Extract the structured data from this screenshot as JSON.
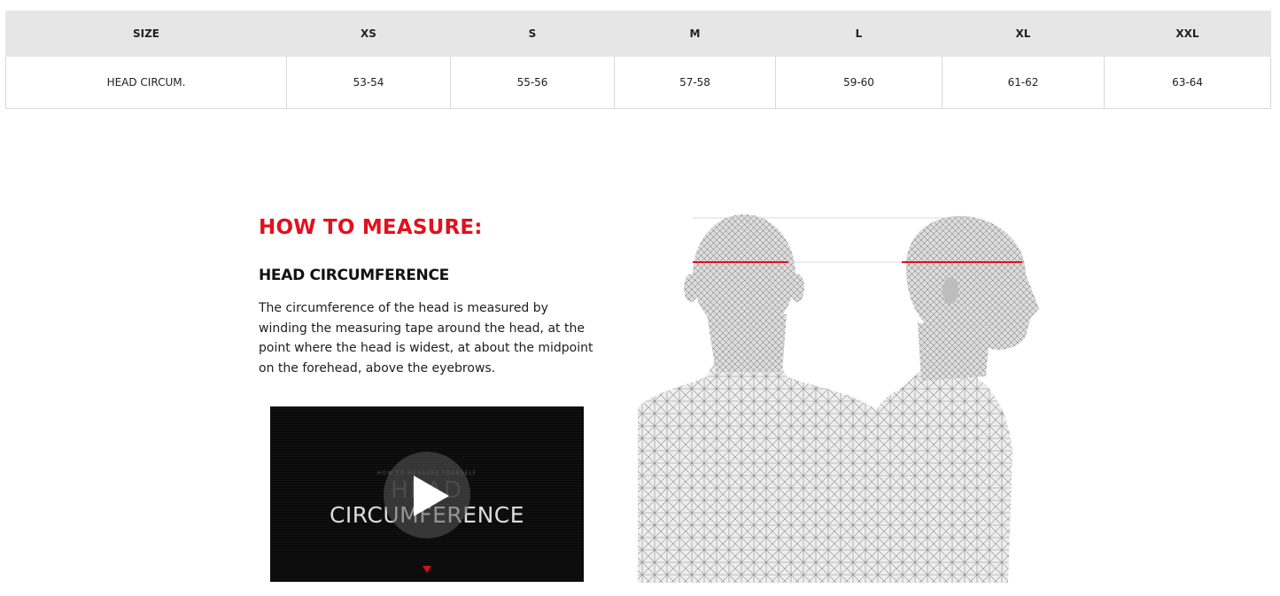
{
  "size_table": {
    "headers": [
      "SIZE",
      "XS",
      "S",
      "M",
      "L",
      "XL",
      "XXL"
    ],
    "rows": [
      [
        "HEAD CIRCUM.",
        "53-54",
        "55-56",
        "57-58",
        "59-60",
        "61-62",
        "63-64"
      ]
    ]
  },
  "how_to_measure": {
    "title": "HOW TO MEASURE:",
    "section_title": "HEAD CIRCUMFERENCE",
    "description": "The circumference of the head is measured by winding the measuring tape around the head, at the point where the head is widest, at about the midpoint on the forehead, above the eyebrows."
  },
  "video": {
    "subtitle": "HOW TO MEASURE YOURSELF",
    "background_word": "HEAD",
    "headline": "CIRCUMFERENCE",
    "play_icon": "play-icon"
  },
  "colors": {
    "accent": "#e3101d",
    "header_bg": "#e6e6e6",
    "border": "#d9d9d9"
  }
}
